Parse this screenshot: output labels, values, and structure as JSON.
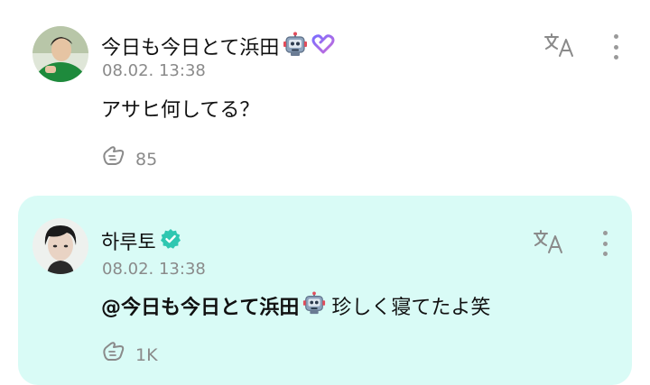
{
  "posts": [
    {
      "author": "今日も今日とて浜田",
      "timestamp": "08.02. 13:38",
      "text": "アサヒ何してる？",
      "reaction_count": "85"
    },
    {
      "author": "하루토",
      "timestamp": "08.02. 13:38",
      "mention": "@今日も今日とて浜田",
      "text": "珍しく寝てたよ笑",
      "reaction_count": "1K"
    }
  ],
  "colors": {
    "reply_background": "#d9fbf6",
    "verified_badge": "#2fc7b1",
    "muted_text": "#8a8a8a"
  },
  "icons": [
    "avatar",
    "robot-icon",
    "heart-icon",
    "verified-badge-icon",
    "translate-icon",
    "more-vertical-icon",
    "reaction-icon"
  ]
}
